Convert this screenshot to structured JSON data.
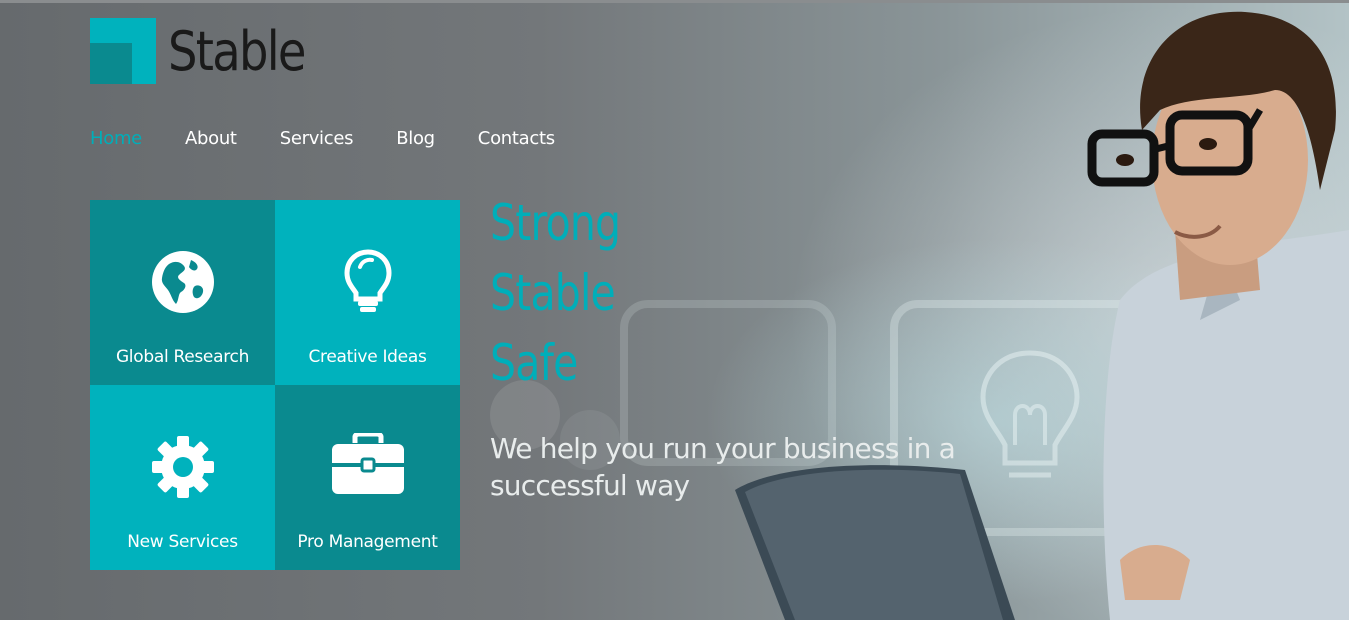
{
  "brand": {
    "logo_text": "Stable",
    "accent": "#00b2bd",
    "accent_dark": "#0a8a8f"
  },
  "nav": {
    "items": [
      {
        "label": "Home",
        "active": true
      },
      {
        "label": "About",
        "active": false
      },
      {
        "label": "Services",
        "active": false
      },
      {
        "label": "Blog",
        "active": false
      },
      {
        "label": "Contacts",
        "active": false
      }
    ]
  },
  "tiles": [
    {
      "label": "Global Research",
      "icon": "globe-icon",
      "color": "#0a8a8f"
    },
    {
      "label": "Creative Ideas",
      "icon": "lightbulb-icon",
      "color": "#00b2bd"
    },
    {
      "label": "New Services",
      "icon": "gear-icon",
      "color": "#00b2bd"
    },
    {
      "label": "Pro Management",
      "icon": "briefcase-icon",
      "color": "#0a8a8f"
    }
  ],
  "hero": {
    "headline": [
      "Strong",
      "Stable",
      "Safe"
    ],
    "tagline": "We help you run your business in a successful way"
  }
}
